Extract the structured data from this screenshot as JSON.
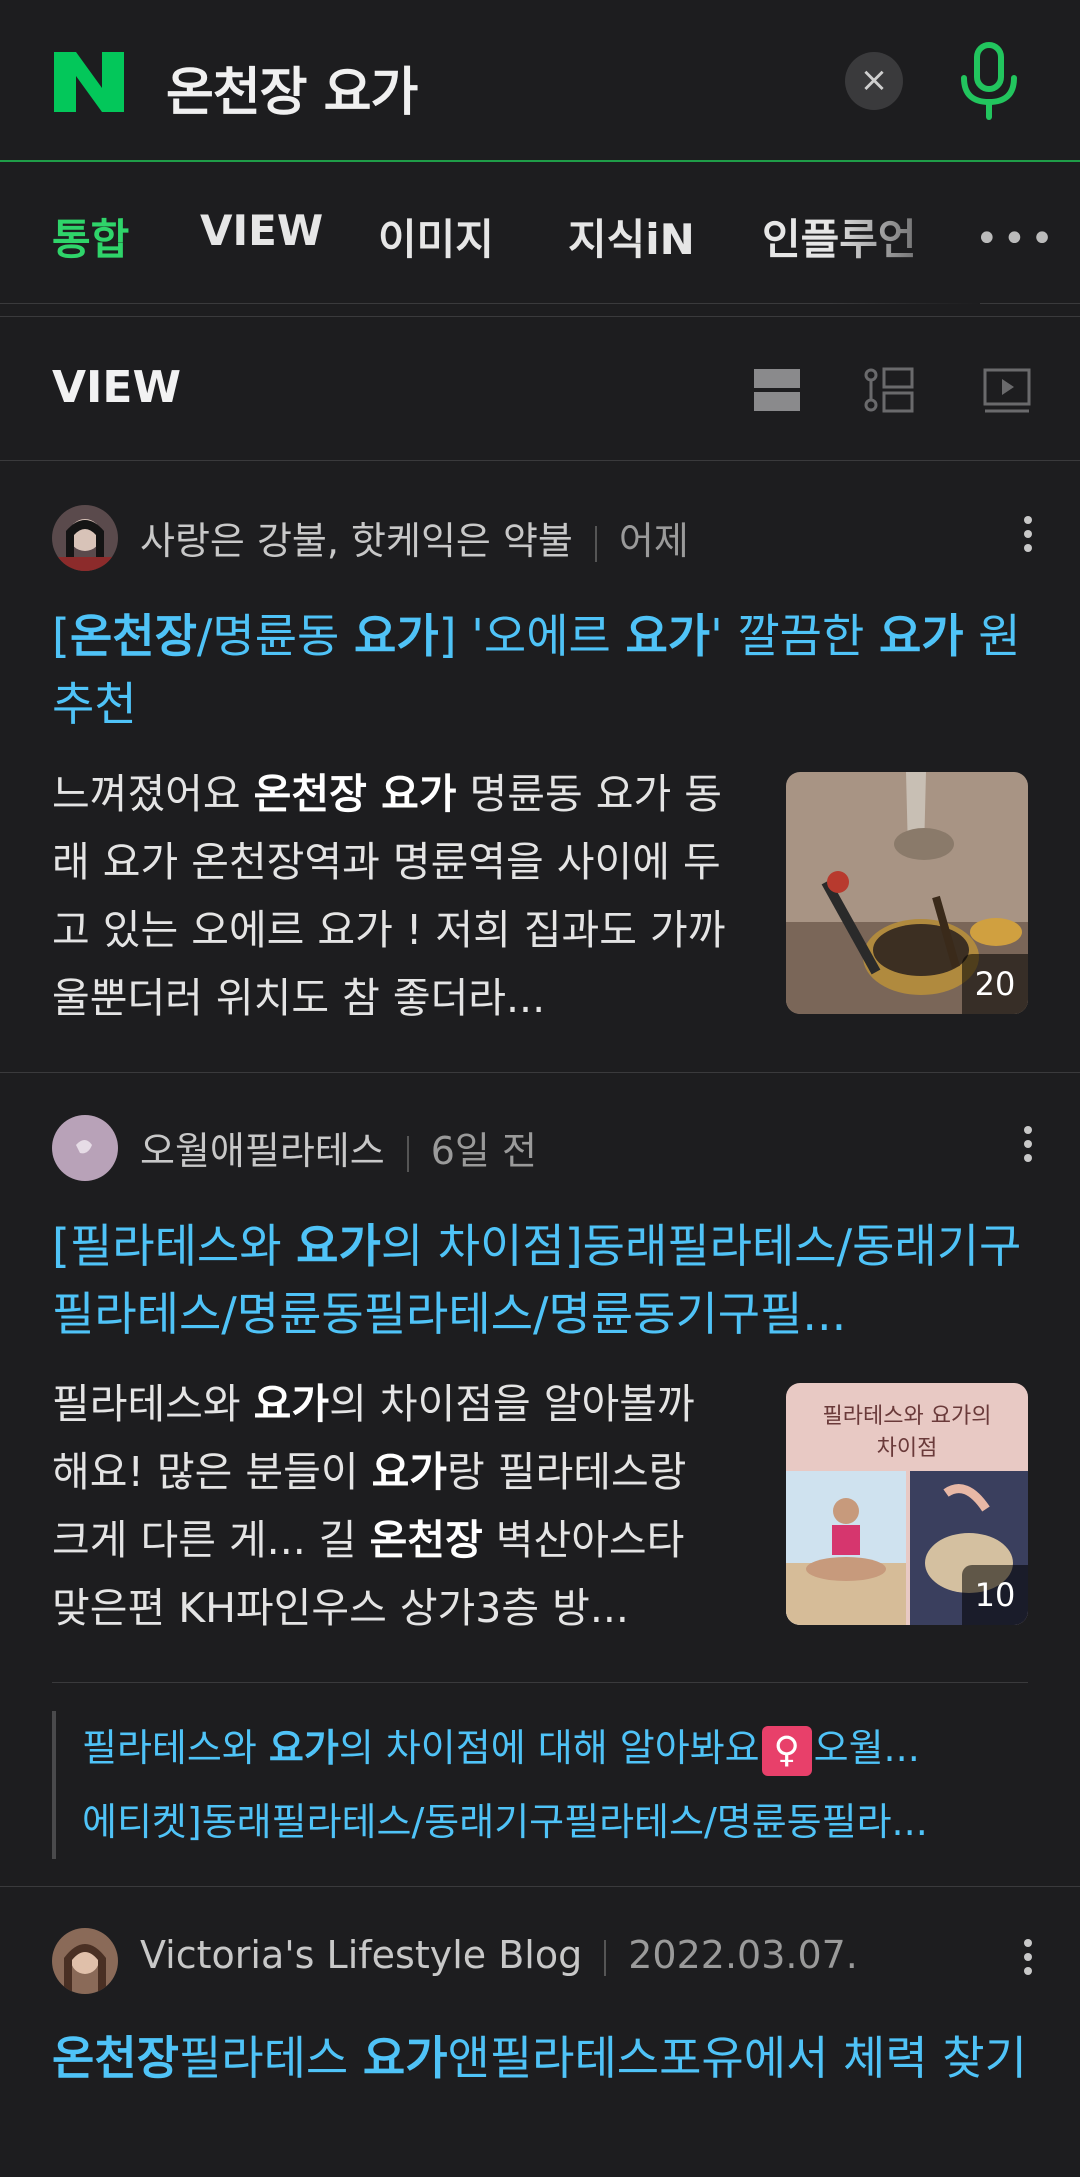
{
  "search": {
    "query": "온천장 요가",
    "clear_icon": "×"
  },
  "tabs": [
    {
      "label": "통합",
      "active": true
    },
    {
      "label": "VIEW"
    },
    {
      "label": "이미지"
    },
    {
      "label": "지식iN"
    },
    {
      "label": "인플루언"
    }
  ],
  "section": {
    "title": "VIEW"
  },
  "posts": [
    {
      "author": "사랑은 강불, 핫케익은 약불",
      "date": "어제",
      "title_parts": [
        "[",
        "온천장",
        "/명륜동 ",
        "요가",
        "] '오에르 ",
        "요가",
        "' 깔끔한 ",
        "요가",
        " 원 추천"
      ],
      "snippet_parts": [
        "느껴졌어요 ",
        "온천장 요가",
        " 명륜동 요가 동래 요가 온천장역과 명륜역을 사이에 두고 있는 오에르 요가 ! 저희 집과도 가까울뿐더러 위치도 참 좋더라..."
      ],
      "thumb_count": "20"
    },
    {
      "author": "오월애필라테스",
      "date": "6일 전",
      "title_parts": [
        "[필라테스와 ",
        "요가",
        "의 차이점]동래필라테스/동래기구필라테스/명륜동필라테스/명륜동기구필..."
      ],
      "snippet_parts": [
        "필라테스와 ",
        "요가",
        "의 차이점을 알아볼까해요! 많은 분들이 ",
        "요가",
        "랑 필라테스랑 크게 다른 게... 길 ",
        "온천장",
        " 벽산아스타 맞은편 KH파인우스 상가3층 방..."
      ],
      "thumb_count": "10",
      "thumb_caption_1": "필라테스와 요가의",
      "thumb_caption_2": "차이점",
      "related": [
        [
          "필라테스와 ",
          "요가",
          "의 차이점에 대해 알아봐요",
          "♀",
          "오월..."
        ],
        [
          "에티켓]동래필라테스/동래기구필라테스/명륜동필라..."
        ]
      ]
    },
    {
      "author": "Victoria's Lifestyle Blog",
      "date": "2022.03.07.",
      "title_parts": [
        "온천장",
        "필라테스 ",
        "요가",
        "앤필라테스포유에서 체력 찾기"
      ]
    }
  ]
}
